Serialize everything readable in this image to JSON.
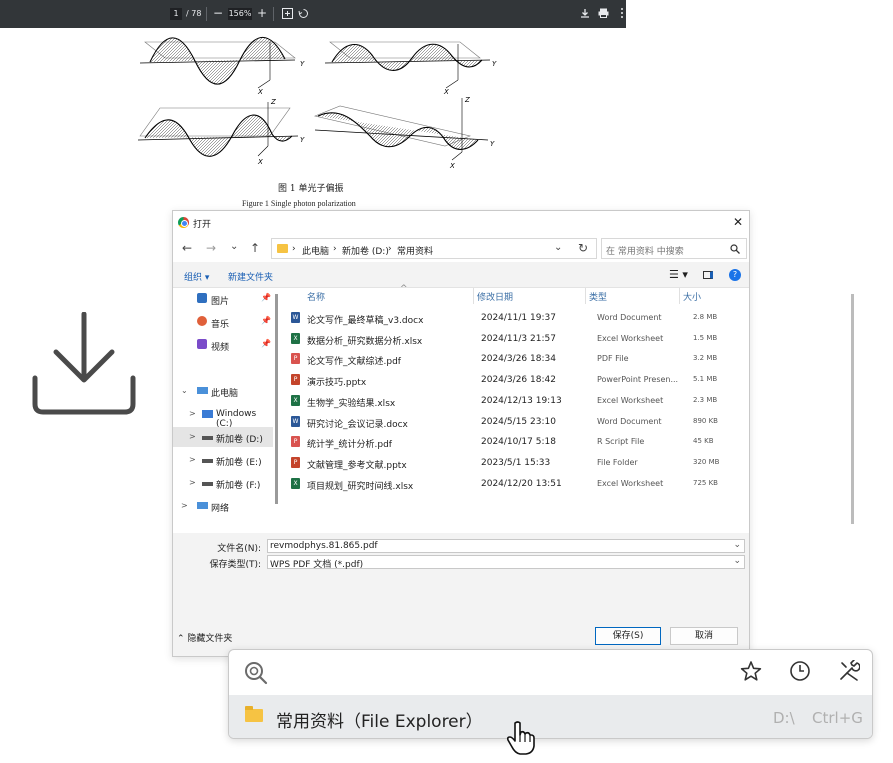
{
  "pdf_viewer": {
    "page_current": "1",
    "page_total": "/ 78",
    "zoom_minus": "−",
    "zoom": "156%",
    "zoom_plus": "+",
    "figure_caption_cn": "图 1   单光子偏振",
    "figure_caption_en": "Figure 1   Single photon polarization",
    "axis_labels": {
      "x": "X",
      "y": "Y",
      "z": "Z"
    }
  },
  "dialog": {
    "title": "打开",
    "close": "✕",
    "nav": {
      "back": "←",
      "forward": "→",
      "down": "⌄",
      "up": "↑"
    },
    "breadcrumb": [
      "此电脑",
      "新加卷 (D:)",
      "常用资料"
    ],
    "search_placeholder": "在 常用资料 中搜索",
    "toolbar": {
      "organize": "组织 ▾",
      "new_folder": "新建文件夹",
      "help": "?"
    },
    "quick_access": [
      {
        "label": "图片",
        "color": "#2f6fbf"
      },
      {
        "label": "音乐",
        "color": "#e0603a"
      },
      {
        "label": "视频",
        "color": "#7a4bc9"
      }
    ],
    "tree": [
      {
        "label": "此电脑",
        "arrow": "⌄",
        "indent": 0
      },
      {
        "label": "Windows (C:)",
        "arrow": ">",
        "indent": 1
      },
      {
        "label": "新加卷 (D:)",
        "arrow": ">",
        "indent": 1,
        "selected": true
      },
      {
        "label": "新加卷 (E:)",
        "arrow": ">",
        "indent": 1
      },
      {
        "label": "新加卷 (F:)",
        "arrow": ">",
        "indent": 1
      },
      {
        "label": "网络",
        "arrow": ">",
        "indent": 0
      }
    ],
    "columns": {
      "name": "名称",
      "date": "修改日期",
      "type": "类型",
      "size": "大小"
    },
    "files": [
      {
        "name": "论文写作_最终草稿_v3.docx",
        "date": "2024/11/1 19:37",
        "type": "Word Document",
        "size": "2.8 MB",
        "kind": "W",
        "color": "#2b5797"
      },
      {
        "name": "数据分析_研究数据分析.xlsx",
        "date": "2024/11/3 21:57",
        "type": "Excel Worksheet",
        "size": "1.5 MB",
        "kind": "X",
        "color": "#1e7145"
      },
      {
        "name": "论文写作_文献综述.pdf",
        "date": "2024/3/26 18:34",
        "type": "PDF File",
        "size": "3.2 MB",
        "kind": "P",
        "color": "#d9534f"
      },
      {
        "name": "演示技巧.pptx",
        "date": "2024/3/26 18:42",
        "type": "PowerPoint Presen...",
        "size": "5.1 MB",
        "kind": "P",
        "color": "#c4442b"
      },
      {
        "name": "生物学_实验结果.xlsx",
        "date": "2024/12/13 19:13",
        "type": "Excel Worksheet",
        "size": "2.3 MB",
        "kind": "X",
        "color": "#1e7145"
      },
      {
        "name": "研究讨论_会议记录.docx",
        "date": "2024/5/15 23:10",
        "type": "Word Document",
        "size": "890 KB",
        "kind": "W",
        "color": "#2b5797"
      },
      {
        "name": "统计学_统计分析.pdf",
        "date": "2024/10/17 5:18",
        "type": "R Script File",
        "size": "45 KB",
        "kind": "P",
        "color": "#d9534f"
      },
      {
        "name": "文献管理_参考文献.pptx",
        "date": "2023/5/1 15:33",
        "type": "File Folder",
        "size": "320 MB",
        "kind": "P",
        "color": "#c4442b"
      },
      {
        "name": "项目规划_研究时间线.xlsx",
        "date": "2024/12/20 13:51",
        "type": "Excel Worksheet",
        "size": "725 KB",
        "kind": "X",
        "color": "#1e7145"
      }
    ],
    "filename_label": "文件名(N):",
    "filename_value": "revmodphys.81.865.pdf",
    "filetype_label": "保存类型(T):",
    "filetype_value": "WPS PDF 文档 (*.pdf)",
    "hide_folders": "隐藏文件夹",
    "save": "保存(S)",
    "cancel": "取消"
  },
  "launcher": {
    "result_text": "常用资料（File Explorer）",
    "result_path": "D:\\",
    "result_hotkey": "Ctrl+G"
  },
  "colors": {
    "accent": "#0067c0",
    "folder": "#f6c343",
    "pdf_toolbar": "#323639"
  }
}
